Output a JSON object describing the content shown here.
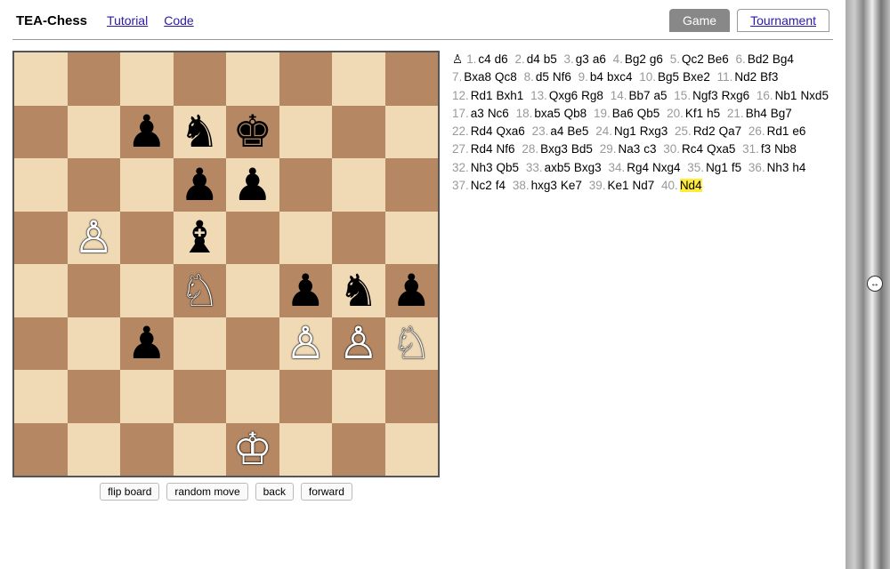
{
  "header": {
    "brand": "TEA-Chess",
    "links": [
      "Tutorial",
      "Code"
    ],
    "tabs": [
      {
        "label": "Game",
        "active": true
      },
      {
        "label": "Tournament",
        "active": false
      }
    ]
  },
  "controls": {
    "flip": "flip board",
    "random": "random move",
    "back": "back",
    "forward": "forward"
  },
  "turn_indicator": "♙",
  "board": {
    "size": 8,
    "light": "#f0d9b5",
    "dark": "#b58863",
    "pieces": [
      {
        "row": 1,
        "col": 2,
        "glyph": "♟",
        "color": "black",
        "name": "black-pawn"
      },
      {
        "row": 1,
        "col": 3,
        "glyph": "♞",
        "color": "black",
        "name": "black-knight"
      },
      {
        "row": 1,
        "col": 4,
        "glyph": "♚",
        "color": "black",
        "name": "black-king"
      },
      {
        "row": 2,
        "col": 3,
        "glyph": "♟",
        "color": "black",
        "name": "black-pawn"
      },
      {
        "row": 2,
        "col": 4,
        "glyph": "♟",
        "color": "black",
        "name": "black-pawn"
      },
      {
        "row": 3,
        "col": 1,
        "glyph": "♙",
        "color": "white",
        "name": "white-pawn"
      },
      {
        "row": 3,
        "col": 3,
        "glyph": "♝",
        "color": "black",
        "name": "black-bishop"
      },
      {
        "row": 4,
        "col": 3,
        "glyph": "♘",
        "color": "white",
        "name": "white-knight"
      },
      {
        "row": 4,
        "col": 5,
        "glyph": "♟",
        "color": "black",
        "name": "black-pawn"
      },
      {
        "row": 4,
        "col": 6,
        "glyph": "♞",
        "color": "black",
        "name": "black-knight"
      },
      {
        "row": 4,
        "col": 7,
        "glyph": "♟",
        "color": "black",
        "name": "black-pawn"
      },
      {
        "row": 5,
        "col": 2,
        "glyph": "♟",
        "color": "black",
        "name": "black-pawn"
      },
      {
        "row": 5,
        "col": 5,
        "glyph": "♙",
        "color": "white",
        "name": "white-pawn"
      },
      {
        "row": 5,
        "col": 6,
        "glyph": "♙",
        "color": "white",
        "name": "white-pawn"
      },
      {
        "row": 5,
        "col": 7,
        "glyph": "♘",
        "color": "white",
        "name": "white-knight"
      },
      {
        "row": 7,
        "col": 4,
        "glyph": "♔",
        "color": "white",
        "name": "white-king"
      }
    ]
  },
  "moves": [
    {
      "n": 1,
      "w": "c4",
      "b": "d6"
    },
    {
      "n": 2,
      "w": "d4",
      "b": "b5"
    },
    {
      "n": 3,
      "w": "g3",
      "b": "a6"
    },
    {
      "n": 4,
      "w": "Bg2",
      "b": "g6"
    },
    {
      "n": 5,
      "w": "Qc2",
      "b": "Be6"
    },
    {
      "n": 6,
      "w": "Bd2",
      "b": "Bg4"
    },
    {
      "n": 7,
      "w": "Bxa8",
      "b": "Qc8"
    },
    {
      "n": 8,
      "w": "d5",
      "b": "Nf6"
    },
    {
      "n": 9,
      "w": "b4",
      "b": "bxc4"
    },
    {
      "n": 10,
      "w": "Bg5",
      "b": "Bxe2"
    },
    {
      "n": 11,
      "w": "Nd2",
      "b": "Bf3"
    },
    {
      "n": 12,
      "w": "Rd1",
      "b": "Bxh1"
    },
    {
      "n": 13,
      "w": "Qxg6",
      "b": "Rg8"
    },
    {
      "n": 14,
      "w": "Bb7",
      "b": "a5"
    },
    {
      "n": 15,
      "w": "Ngf3",
      "b": "Rxg6"
    },
    {
      "n": 16,
      "w": "Nb1",
      "b": "Nxd5"
    },
    {
      "n": 17,
      "w": "a3",
      "b": "Nc6"
    },
    {
      "n": 18,
      "w": "bxa5",
      "b": "Qb8"
    },
    {
      "n": 19,
      "w": "Ba6",
      "b": "Qb5"
    },
    {
      "n": 20,
      "w": "Kf1",
      "b": "h5"
    },
    {
      "n": 21,
      "w": "Bh4",
      "b": "Bg7"
    },
    {
      "n": 22,
      "w": "Rd4",
      "b": "Qxa6"
    },
    {
      "n": 23,
      "w": "a4",
      "b": "Be5"
    },
    {
      "n": 24,
      "w": "Ng1",
      "b": "Rxg3"
    },
    {
      "n": 25,
      "w": "Rd2",
      "b": "Qa7"
    },
    {
      "n": 26,
      "w": "Rd1",
      "b": "e6"
    },
    {
      "n": 27,
      "w": "Rd4",
      "b": "Nf6"
    },
    {
      "n": 28,
      "w": "Bxg3",
      "b": "Bd5"
    },
    {
      "n": 29,
      "w": "Na3",
      "b": "c3"
    },
    {
      "n": 30,
      "w": "Rc4",
      "b": "Qxa5"
    },
    {
      "n": 31,
      "w": "f3",
      "b": "Nb8"
    },
    {
      "n": 32,
      "w": "Nh3",
      "b": "Qb5"
    },
    {
      "n": 33,
      "w": "axb5",
      "b": "Bxg3"
    },
    {
      "n": 34,
      "w": "Rg4",
      "b": "Nxg4"
    },
    {
      "n": 35,
      "w": "Ng1",
      "b": "f5"
    },
    {
      "n": 36,
      "w": "Nh3",
      "b": "h4"
    },
    {
      "n": 37,
      "w": "Nc2",
      "b": "f4"
    },
    {
      "n": 38,
      "w": "hxg3",
      "b": "Ke7"
    },
    {
      "n": 39,
      "w": "Ke1",
      "b": "Nd7"
    },
    {
      "n": 40,
      "w": "Nd4",
      "b": null,
      "hiW": true
    }
  ]
}
